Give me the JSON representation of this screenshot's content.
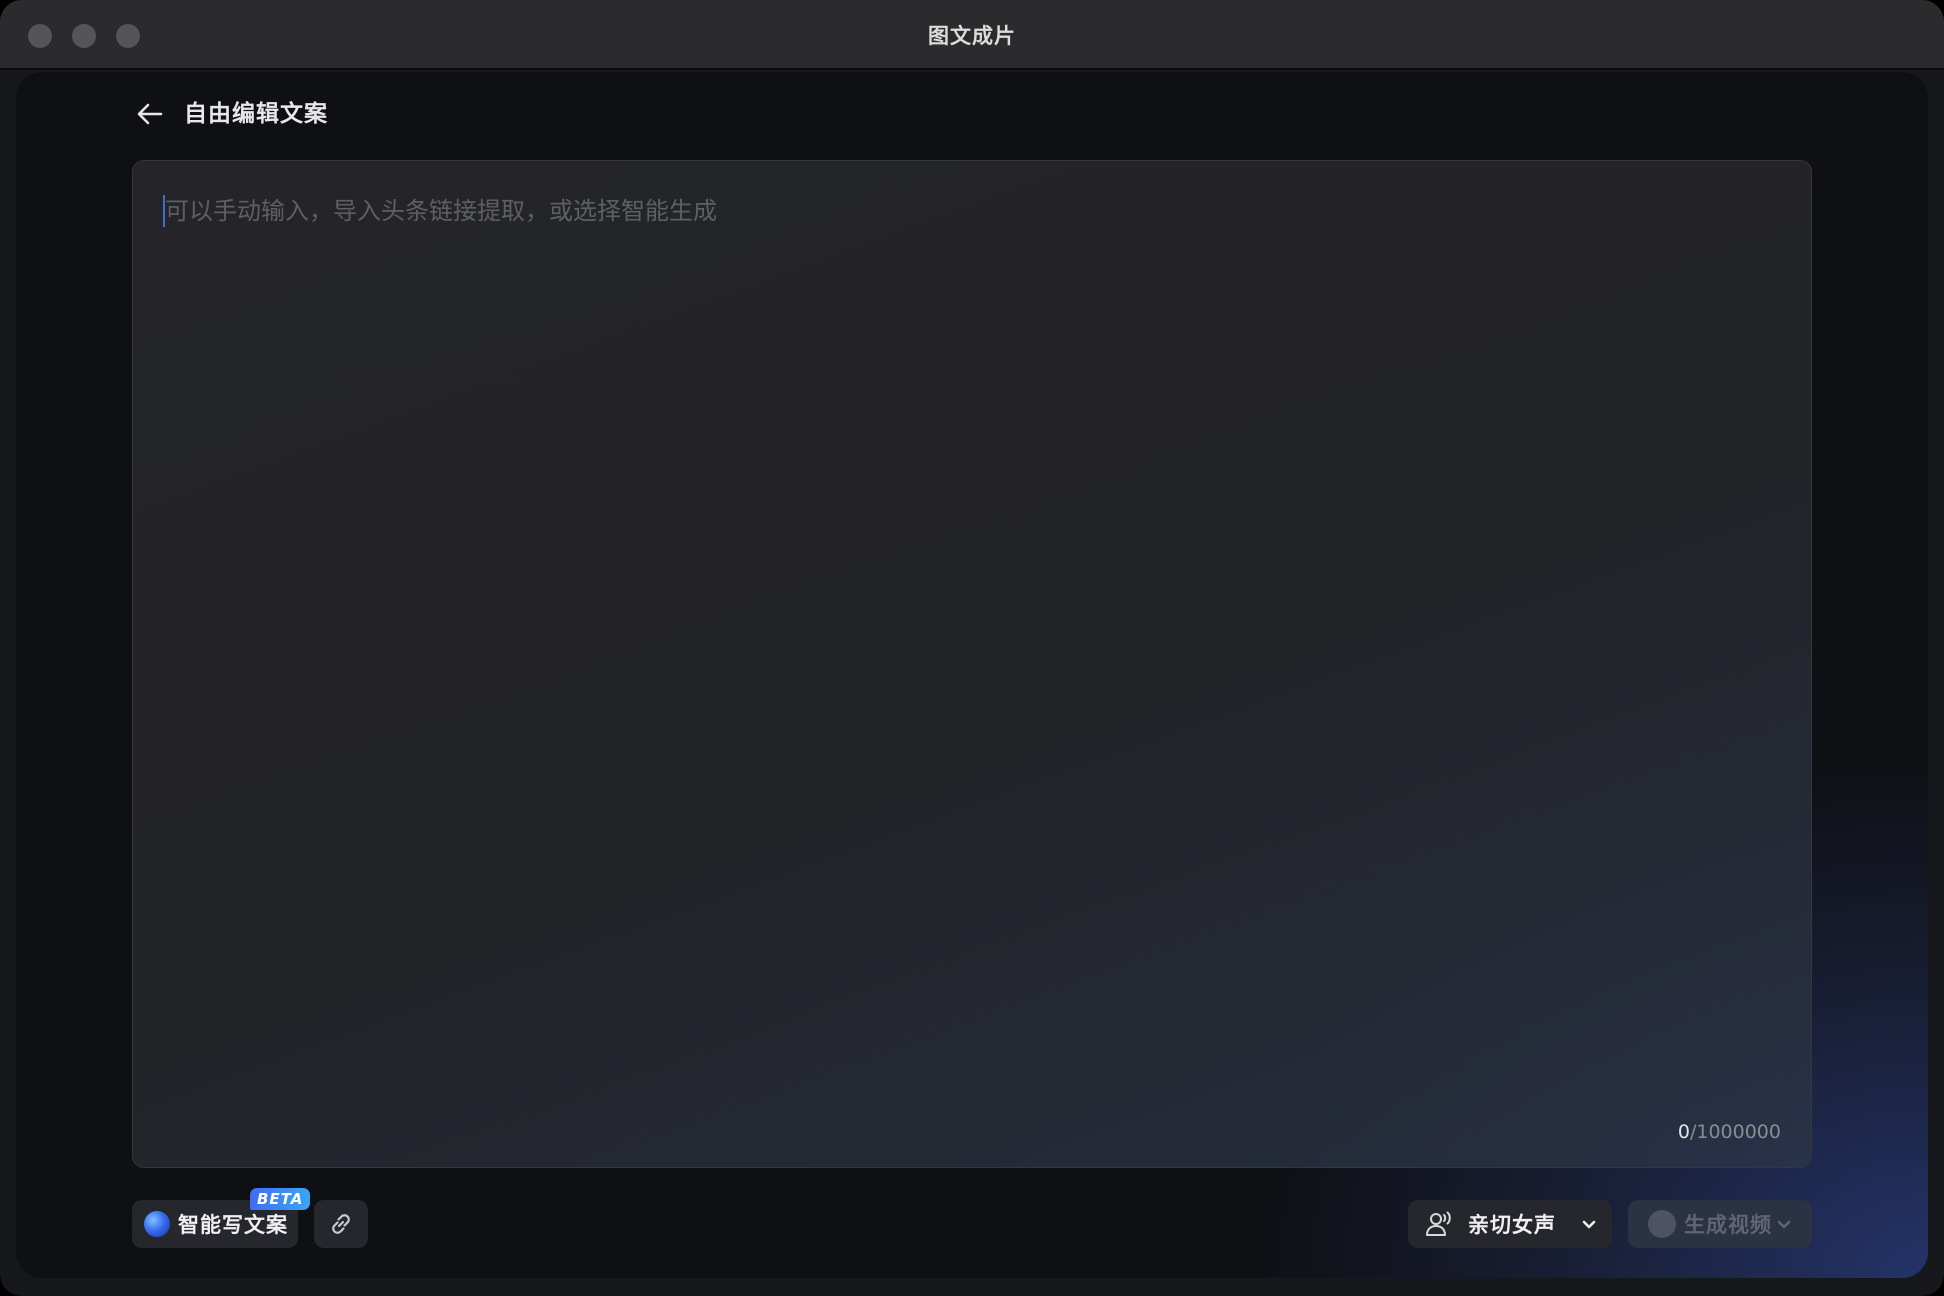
{
  "window": {
    "title": "图文成片"
  },
  "header": {
    "page_title": "自由编辑文案"
  },
  "editor": {
    "placeholder": "可以手动输入，导入头条链接提取，或选择智能生成",
    "value": "",
    "char_count": "0",
    "char_limit": "/1000000"
  },
  "toolbar": {
    "ai_write_label": "智能写文案",
    "beta_badge": "BETA",
    "voice_label": "亲切女声",
    "generate_label": "生成视频"
  },
  "icons": {
    "back": "arrow-left-icon",
    "link": "link-icon",
    "voice": "voice-person-icon",
    "chevron": "chevron-down-icon"
  },
  "colors": {
    "accent": "#3f6cf6",
    "panel_bg": "#0f1014",
    "button_bg": "#26272c",
    "disabled_bg": "#2b3244"
  }
}
